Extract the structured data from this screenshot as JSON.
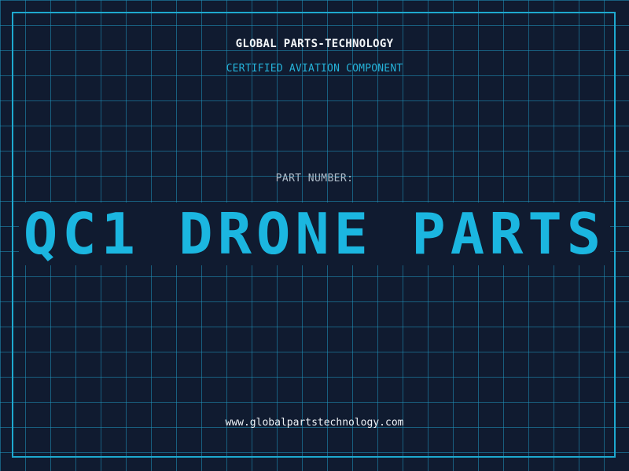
{
  "header": {
    "company": "GLOBAL PARTS-TECHNOLOGY",
    "tagline": "CERTIFIED AVIATION COMPONENT"
  },
  "part": {
    "label": "PART NUMBER:",
    "number": "QC1 DRONE PARTS"
  },
  "footer": {
    "website": "www.globalpartstechnology.com"
  },
  "colors": {
    "background": "#101b30",
    "grid": "#2096be",
    "accent": "#1bb6e0",
    "text": "#f2f5f8"
  }
}
